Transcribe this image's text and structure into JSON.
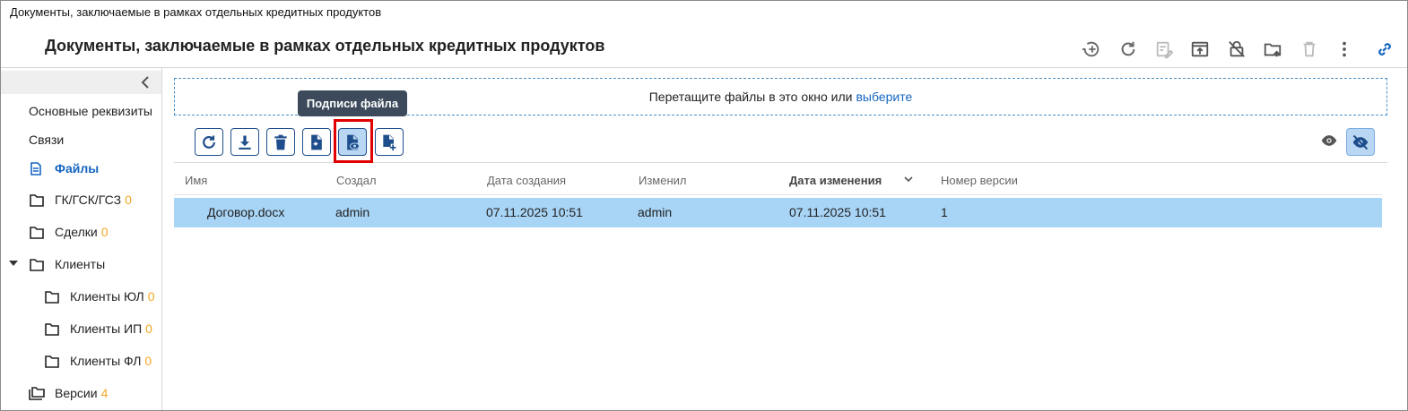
{
  "window": {
    "title": "Документы, заключаемые в рамках отдельных кредитных продуктов"
  },
  "header": {
    "title": "Документы, заключаемые в рамках отдельных кредитных продуктов",
    "toolbar_icons": [
      "add-circle-icon",
      "refresh-icon",
      "edit-doc-icon",
      "open-in-icon",
      "lock-off-icon",
      "folder-move-icon",
      "delete-icon",
      "more-vert-icon",
      "link-icon"
    ]
  },
  "sidebar": {
    "items": [
      {
        "label": "Основные реквизиты"
      },
      {
        "label": "Связи"
      },
      {
        "label": "Файлы",
        "active": true
      },
      {
        "label": "ГК/ГСК/ГСЗ",
        "count": "0"
      },
      {
        "label": "Сделки",
        "count": "0"
      },
      {
        "label": "Клиенты",
        "expanded": true
      },
      {
        "label": "Клиенты ЮЛ",
        "count": "0"
      },
      {
        "label": "Клиенты ИП",
        "count": "0"
      },
      {
        "label": "Клиенты ФЛ",
        "count": "0"
      },
      {
        "label": "Версии",
        "count": "4"
      }
    ]
  },
  "dropzone": {
    "text": "Перетащите файлы в это окно или",
    "link": "выберите"
  },
  "tooltip": {
    "text": "Подписи файла"
  },
  "file_toolbar": {
    "buttons": [
      "refresh-icon",
      "download-icon",
      "delete-icon",
      "sign-file-icon",
      "file-signatures-icon",
      "add-file-icon"
    ]
  },
  "table": {
    "columns": [
      "Имя",
      "Создал",
      "Дата создания",
      "Изменил",
      "Дата изменения",
      "Номер версии"
    ],
    "rows": [
      [
        "Договор.docx",
        "admin",
        "07.11.2025 10:51",
        "admin",
        "07.11.2025 10:51",
        "1"
      ]
    ]
  },
  "colors": {
    "accent": "#1565c0",
    "selected_row": "#a8d4f5",
    "count": "#f5a623",
    "highlight": "#e00000"
  }
}
